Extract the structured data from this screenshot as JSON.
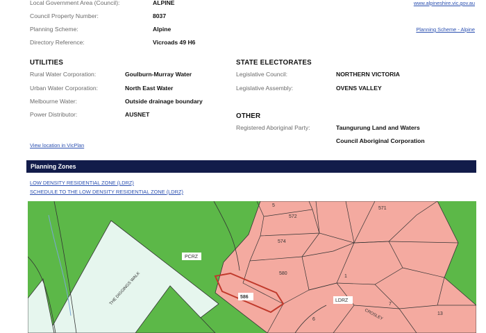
{
  "property": {
    "lga_label": "Local Government Area (Council):",
    "lga_value": "ALPINE",
    "lga_link": "www.alpineshire.vic.gov.au",
    "cpn_label": "Council Property Number:",
    "cpn_value": "8037",
    "scheme_label": "Planning Scheme:",
    "scheme_value": "Alpine",
    "scheme_link": "Planning Scheme - Alpine",
    "dir_label": "Directory Reference:",
    "dir_value": "Vicroads 49 H6"
  },
  "utilities": {
    "heading": "UTILITIES",
    "rural_label": "Rural Water Corporation:",
    "rural_value": "Goulburn-Murray Water",
    "urban_label": "Urban Water Corporation:",
    "urban_value": "North East Water",
    "melb_label": "Melbourne Water:",
    "melb_value": "Outside drainage boundary",
    "power_label": "Power Distributor:",
    "power_value": "AUSNET"
  },
  "electorates": {
    "heading": "STATE ELECTORATES",
    "council_label": "Legislative Council:",
    "council_value": "NORTHERN VICTORIA",
    "assembly_label": "Legislative Assembly:",
    "assembly_value": "OVENS VALLEY"
  },
  "other": {
    "heading": "OTHER",
    "aboriginal_label": "Registered Aboriginal Party:",
    "aboriginal_value_line1": "Taungurung Land and Waters",
    "aboriginal_value_line2": "Council Aboriginal Corporation"
  },
  "view_link": "View location in VicPlan",
  "zones": {
    "heading": "Planning Zones",
    "link1": "LOW DENSITY RESIDENTIAL ZONE (LDRZ)",
    "link2": "SCHEDULE TO THE LOW DENSITY RESIDENTIAL ZONE (LDRZ)"
  },
  "map": {
    "colors": {
      "green": "#5cb848",
      "pink": "#f4aaa0",
      "pale": "#e6f6ee",
      "parcel": "#c0392b"
    },
    "zone_labels": [
      "PCRZ",
      "LDRZ"
    ],
    "lot_numbers": [
      "5",
      "572",
      "571",
      "574",
      "580",
      "1",
      "586",
      "7",
      "6",
      "13"
    ],
    "road_labels": [
      "THE DIGGINGS WALK",
      "CROSLEY"
    ]
  }
}
